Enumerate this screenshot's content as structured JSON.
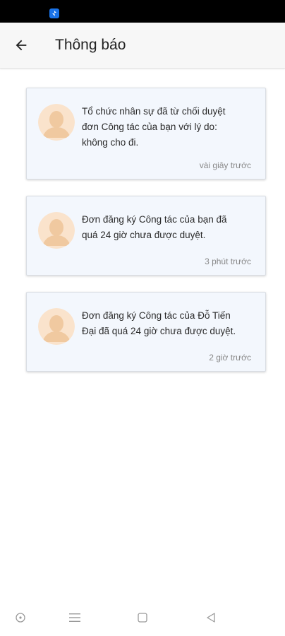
{
  "header": {
    "title": "Thông báo"
  },
  "notifications": [
    {
      "message": "Tổ chức nhân sự đã từ chối duyệt\nđơn Công tác của bạn với lý do:\nkhông cho đi.",
      "time": "vài giây trước"
    },
    {
      "message": "Đơn đăng ký Công tác của bạn đã\nquá 24 giờ chưa được duyệt.",
      "time": "3 phút trước"
    },
    {
      "message": "Đơn đăng ký Công tác của Đỗ Tiến\nĐại đã quá 24 giờ chưa được duyệt.",
      "time": "2 giờ trước"
    }
  ],
  "colors": {
    "card_background": "#f3f7fd",
    "status_icon": "#1a73e8",
    "avatar_skin": "#f0c9a0"
  }
}
